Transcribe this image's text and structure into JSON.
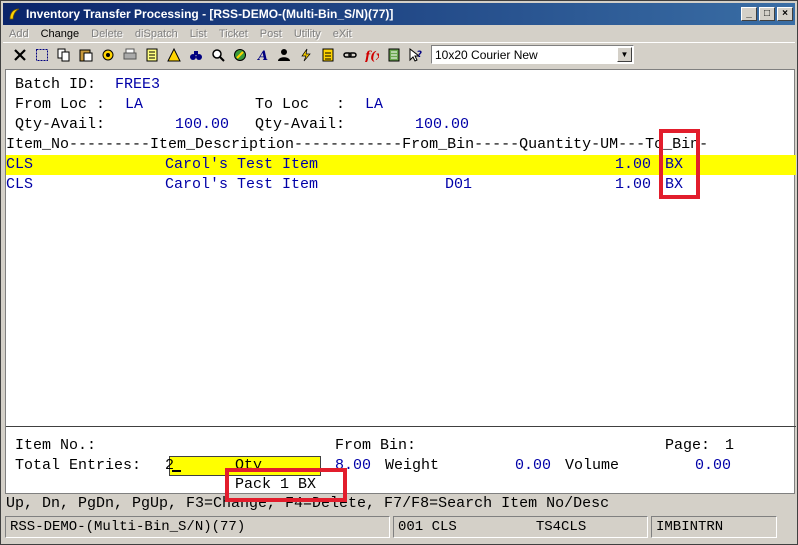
{
  "window": {
    "title": "Inventory Transfer Processing - [RSS-DEMO-(Multi-Bin_S/N)(77)]",
    "buttons": {
      "minimize": "_",
      "maximize": "□",
      "close": "×"
    }
  },
  "menu": [
    {
      "label": "Add",
      "enabled": false
    },
    {
      "label": "Change",
      "enabled": true
    },
    {
      "label": "Delete",
      "enabled": false
    },
    {
      "label": "diSpatch",
      "enabled": false
    },
    {
      "label": "List",
      "enabled": false
    },
    {
      "label": "Ticket",
      "enabled": false
    },
    {
      "label": "Post",
      "enabled": false
    },
    {
      "label": "Utility",
      "enabled": false
    },
    {
      "label": "eXit",
      "enabled": false
    }
  ],
  "toolbar": {
    "icons": [
      "close-icon",
      "select-icon",
      "copy-icon",
      "paste-icon",
      "settings-icon",
      "print-setup-icon",
      "notes-icon",
      "alert-icon",
      "binoculars-icon",
      "magnifier-icon",
      "tools-icon",
      "font-icon",
      "user-icon",
      "lightning-icon",
      "calculator-icon",
      "link-icon",
      "function-icon",
      "notebook-icon",
      "help-pointer-icon"
    ],
    "font_select": "10x20 Courier New"
  },
  "header": {
    "batch_label": "Batch ID:",
    "batch_value": "FREE3",
    "from_loc_label": "From Loc :",
    "from_loc_value": "LA",
    "to_loc_label": "To Loc   :",
    "to_loc_value": "LA",
    "from_qty_label": "Qty-Avail:",
    "from_qty_value": "100.00",
    "to_qty_label": "Qty-Avail:",
    "to_qty_value": "100.00"
  },
  "grid": {
    "header": "Item_No---------Item_Description------------From_Bin-----Quantity-UM---To_Bin-",
    "rows": [
      {
        "item_no": "CLS",
        "description": "Carol's Test Item",
        "from_bin": "",
        "quantity": "1.00",
        "um": "BX",
        "to_bin": ""
      },
      {
        "item_no": "CLS",
        "description": "Carol's Test Item",
        "from_bin": "D01",
        "quantity": "1.00",
        "um": "BX",
        "to_bin": ""
      }
    ]
  },
  "footer": {
    "item_no_label": "Item No.:",
    "item_no_value": "",
    "from_bin_label": "From Bin:",
    "page_label": "Page:",
    "page_value": "1",
    "total_entries_label": "Total Entries:",
    "total_entries_value": "2",
    "qty_label": "Qty",
    "qty_value": "8.00",
    "weight_label": "Weight",
    "weight_value": "0.00",
    "volume_label": "Volume",
    "volume_value": "0.00",
    "pack_text": "Pack 1 BX"
  },
  "function_keys": "Up, Dn, PgDn, PgUp, F3=Change, F4=Delete, F7/F8=Search Item No/Desc",
  "status": {
    "company": "RSS-DEMO-(Multi-Bin_S/N)(77)",
    "location_item": "001 CLS",
    "terminal": "TS4CLS",
    "program": "IMBINTRN"
  },
  "colors": {
    "highlight": "#ffff00",
    "annotation": "#e21d2c",
    "value_blue": "#0000a8"
  }
}
